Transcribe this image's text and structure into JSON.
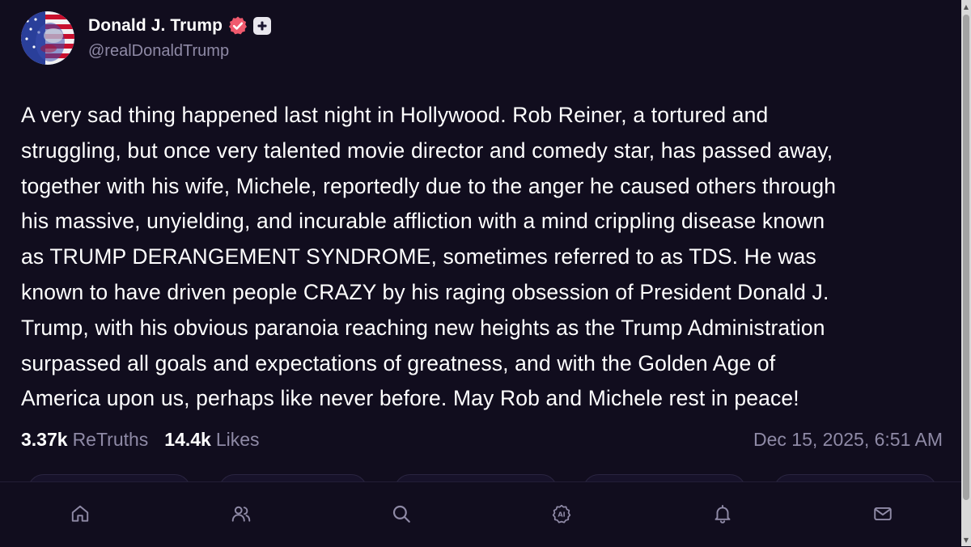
{
  "account": {
    "display_name": "Donald J. Trump",
    "handle": "@realDonaldTrump",
    "verified_icon": "verified-badge-icon",
    "plus_icon": "plus-badge-icon"
  },
  "post": {
    "lines": [
      "A very sad thing happened last night in Hollywood. Rob Reiner, a tortured and",
      "struggling, but once very talented movie director and comedy star, has passed away,",
      "together with his wife, Michele, reportedly due to the anger he caused others through",
      "his massive, unyielding, and incurable affliction with a mind crippling disease known",
      "as TRUMP DERANGEMENT SYNDROME, sometimes referred to as TDS. He was",
      "known to have driven people CRAZY by his raging obsession of President Donald J.",
      "Trump, with his obvious paranoia reaching new heights as the Trump Administration",
      "surpassed all goals and expectations of greatness, and with the Golden Age of",
      "America upon us, perhaps like never before. May Rob and Michele rest in peace!"
    ]
  },
  "stats": {
    "retruths_count": "3.37k",
    "retruths_label": "ReTruths",
    "likes_count": "14.4k",
    "likes_label": "Likes",
    "timestamp": "Dec 15, 2025, 6:51 AM"
  },
  "nav": [
    {
      "icon": "home-icon"
    },
    {
      "icon": "people-icon"
    },
    {
      "icon": "search-icon"
    },
    {
      "icon": "ai-icon"
    },
    {
      "icon": "bell-icon"
    },
    {
      "icon": "mail-icon"
    }
  ],
  "colors": {
    "background": "#110d1e",
    "text": "#ffffff",
    "muted": "#8f8aa6",
    "verified": "#f05a6e"
  }
}
